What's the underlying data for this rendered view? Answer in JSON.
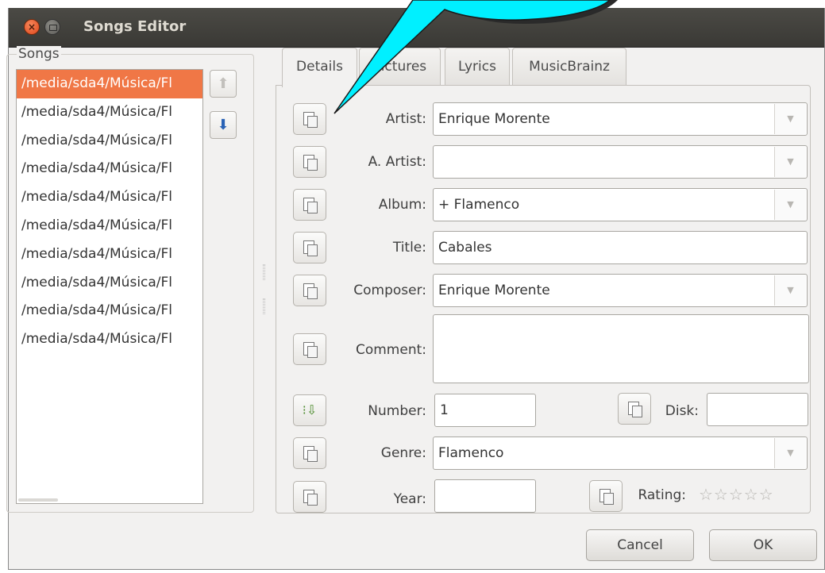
{
  "window": {
    "title": "Songs Editor",
    "close_glyph": "×"
  },
  "songs": {
    "label": "Songs",
    "items": [
      "/media/sda4/Música/Fl",
      "/media/sda4/Música/Fl",
      "/media/sda4/Música/Fl",
      "/media/sda4/Música/Fl",
      "/media/sda4/Música/Fl",
      "/media/sda4/Música/Fl",
      "/media/sda4/Música/Fl",
      "/media/sda4/Música/Fl",
      "/media/sda4/Música/Fl",
      "/media/sda4/Música/Fl"
    ],
    "selected_index": 0,
    "move_up_icon": "arrow-up-icon",
    "move_down_icon": "arrow-down-icon"
  },
  "tabs": [
    "Details",
    "Pictures",
    "Lyrics",
    "MusicBrainz"
  ],
  "active_tab": "Details",
  "details": {
    "artist_label": "Artist:",
    "artist_value": "Enrique Morente",
    "album_artist_label": "A. Artist:",
    "album_artist_value": "",
    "album_label": "Album:",
    "album_value": "+ Flamenco",
    "title_label": "Title:",
    "title_value": "Cabales",
    "composer_label": "Composer:",
    "composer_value": "Enrique Morente",
    "comment_label": "Comment:",
    "comment_value": "",
    "number_label": "Number:",
    "number_value": "1",
    "disk_label": "Disk:",
    "disk_value": "",
    "genre_label": "Genre:",
    "genre_value": "Flamenco",
    "year_label": "Year:",
    "year_value": "",
    "rating_label": "Rating:",
    "rating_value": 0,
    "rating_max": 5,
    "rating_stars": "☆☆☆☆☆",
    "combo_arrow": "▼",
    "copy_icon": "copy-to-all-icon",
    "autonumber_icon": "auto-number-icon"
  },
  "buttons": {
    "cancel": "Cancel",
    "ok": "OK"
  },
  "glyphs": {
    "up": "⬆",
    "down": "⬇",
    "autonumber": "⁝⇩"
  },
  "colors": {
    "titlebar": "#3c3b37",
    "selection": "#f07746",
    "callout_fill": "#00f0ff",
    "dialog_bg": "#f2f1f0"
  }
}
